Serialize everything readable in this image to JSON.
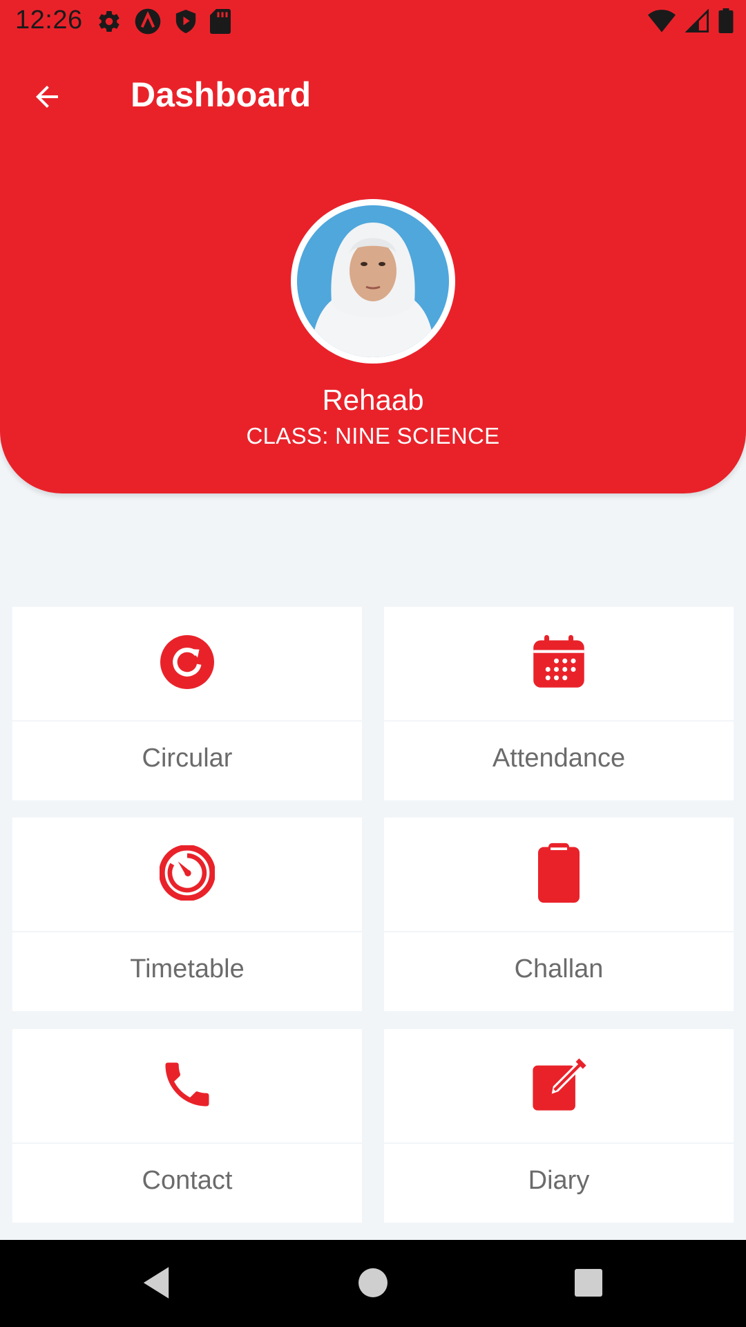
{
  "status_bar": {
    "time": "12:26",
    "left_icons": [
      "gear-icon",
      "arc-app-icon",
      "shield-play-icon",
      "sd-card-icon"
    ],
    "right_icons": [
      "wifi-icon",
      "cellular-signal-icon",
      "battery-icon"
    ]
  },
  "toolbar": {
    "title": "Dashboard",
    "back_icon": "arrow-left-icon"
  },
  "profile": {
    "name": "Rehaab",
    "class": "CLASS: NINE SCIENCE"
  },
  "menu": [
    {
      "label": "Circular",
      "icon": "refresh-circle-icon"
    },
    {
      "label": "Attendance",
      "icon": "calendar-icon"
    },
    {
      "label": "Timetable",
      "icon": "timer-icon"
    },
    {
      "label": "Challan",
      "icon": "clipboard-icon"
    },
    {
      "label": "Contact",
      "icon": "phone-icon"
    },
    {
      "label": "Diary",
      "icon": "edit-icon"
    }
  ],
  "colors": {
    "accent": "#e9222a",
    "background": "#f2f5f8",
    "label_text": "#6b6b6b"
  }
}
